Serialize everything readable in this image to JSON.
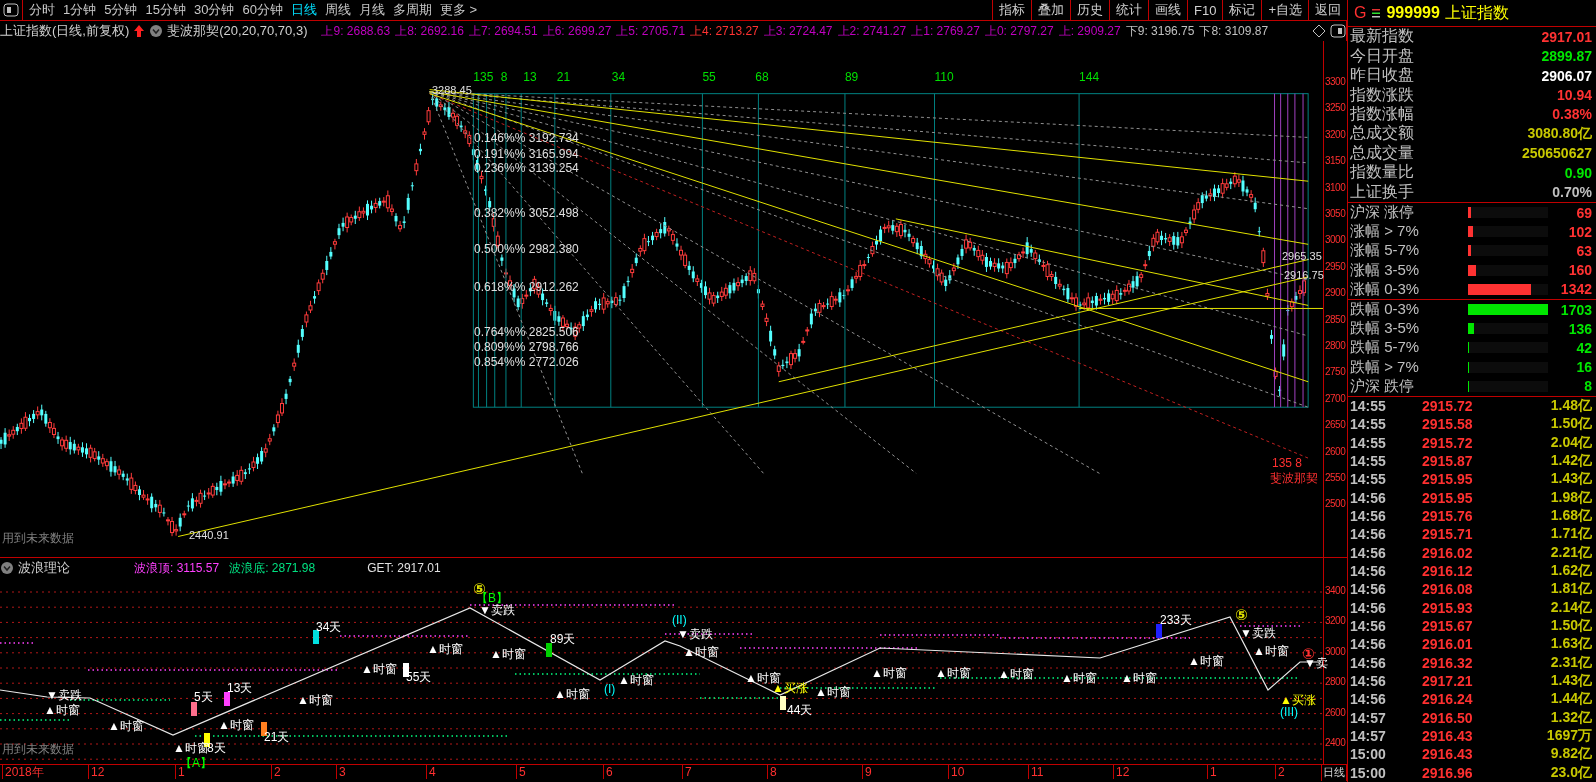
{
  "toolbar": {
    "periods": [
      {
        "label": "分时",
        "selected": false
      },
      {
        "label": "1分钟",
        "selected": false
      },
      {
        "label": "5分钟",
        "selected": false
      },
      {
        "label": "15分钟",
        "selected": false
      },
      {
        "label": "30分钟",
        "selected": false
      },
      {
        "label": "60分钟",
        "selected": false
      },
      {
        "label": "日线",
        "selected": true
      },
      {
        "label": "周线",
        "selected": false
      },
      {
        "label": "月线",
        "selected": false
      },
      {
        "label": "多周期",
        "selected": false
      },
      {
        "label": "更多 >",
        "selected": false
      }
    ],
    "buttons": [
      "指标",
      "叠加",
      "历史",
      "统计",
      "画线",
      "F10",
      "标记",
      "+自选",
      "返回"
    ]
  },
  "info_bar": {
    "title": "上证指数(日线,前复权)",
    "indicator": "斐波那契(20,20,70,70,3)",
    "levels": [
      {
        "text": "上9: 2688.63",
        "color": "#c000c0"
      },
      {
        "text": "上8: 2692.16",
        "color": "#c000c0"
      },
      {
        "text": "上7: 2694.51",
        "color": "#c000c0"
      },
      {
        "text": "上6: 2699.27",
        "color": "#c000c0"
      },
      {
        "text": "上5: 2705.71",
        "color": "#c000c0"
      },
      {
        "text": "上4: 2713.27",
        "color": "#ff3232"
      },
      {
        "text": "上3: 2724.47",
        "color": "#c000c0"
      },
      {
        "text": "上2: 2741.27",
        "color": "#c000c0"
      },
      {
        "text": "上1: 2769.27",
        "color": "#c000c0"
      },
      {
        "text": "上0: 2797.27",
        "color": "#c000c0"
      },
      {
        "text": "上: 2909.27",
        "color": "#c000c0"
      },
      {
        "text": "下9: 3196.75",
        "color": "#c0c0c0"
      },
      {
        "text": "下8: 3109.87",
        "color": "#c0c0c0"
      }
    ]
  },
  "main_chart": {
    "axis_labels": [
      "3300",
      "3250",
      "3200",
      "3150",
      "3100",
      "3050",
      "3000",
      "2950",
      "2900",
      "2850",
      "2800",
      "2750",
      "2700",
      "2650",
      "2600",
      "2550",
      "2500"
    ],
    "fib_days": [
      "135",
      "8",
      "13",
      "21",
      "34",
      "55",
      "68",
      "89",
      "110",
      "144"
    ],
    "fib_levels": [
      "0.146%% 3192.734",
      "0.191%% 3165.994",
      "0.236%% 3139.254",
      "0.382%% 3052.498",
      "0.500%% 2982.380",
      "0.618%% 2912.262",
      "0.764%% 2825.506",
      "0.809%% 2798.766",
      "0.854%% 2772.026"
    ],
    "price_marks": [
      "3288.45",
      "2440.91",
      "2965.35",
      "2916.75"
    ],
    "corner_labels": [
      "135 8",
      "斐波那契"
    ],
    "note": "用到未来数据"
  },
  "wave_panel": {
    "title": "波浪理论",
    "top_label": "波浪顶: 3115.57",
    "bottom_label": "波浪底: 2871.98",
    "get_label": "GET: 2917.01",
    "axis_labels": [
      "3400",
      "3200",
      "3000",
      "2800",
      "2600",
      "2400"
    ],
    "markers": [
      {
        "kind": "sell",
        "text": "▼卖跌"
      },
      {
        "kind": "window",
        "text": "▲时窗"
      },
      {
        "kind": "window",
        "text": "▲时窗"
      },
      {
        "kind": "days",
        "text": "5天",
        "color": "#ff6e8c"
      },
      {
        "kind": "days",
        "text": "13天",
        "color": "#ff40ff"
      },
      {
        "kind": "days",
        "text": "34天",
        "color": "#00e0e0"
      },
      {
        "kind": "window",
        "text": "▲时窗"
      },
      {
        "kind": "window",
        "text": "▲时窗"
      },
      {
        "kind": "days",
        "text": "21天",
        "color": "#ff8020"
      },
      {
        "kind": "days",
        "text": "8天",
        "color": "#ffff00"
      },
      {
        "kind": "window",
        "text": "▲时窗"
      },
      {
        "kind": "point",
        "text": "【A】"
      },
      {
        "kind": "window",
        "text": "▲时窗"
      },
      {
        "kind": "days",
        "text": "55天",
        "color": "#ffffff"
      },
      {
        "kind": "window",
        "text": "▲时窗"
      },
      {
        "kind": "count",
        "text": "⑤",
        "color": "#e0e000"
      },
      {
        "kind": "point",
        "text": "【B】"
      },
      {
        "kind": "sell",
        "text": "▼卖跌"
      },
      {
        "kind": "window",
        "text": "▲时窗"
      },
      {
        "kind": "days",
        "text": "89天",
        "color": "#00d000"
      },
      {
        "kind": "window",
        "text": "▲时窗"
      },
      {
        "kind": "wave",
        "text": "(I)"
      },
      {
        "kind": "window",
        "text": "▲时窗"
      },
      {
        "kind": "wave",
        "text": "(II)"
      },
      {
        "kind": "sell",
        "text": "▼卖跌"
      },
      {
        "kind": "window",
        "text": "▲时窗"
      },
      {
        "kind": "window",
        "text": "▲时窗"
      },
      {
        "kind": "buy",
        "text": "▲买涨"
      },
      {
        "kind": "window",
        "text": "▲时窗"
      },
      {
        "kind": "days",
        "text": "44天",
        "color": "#ffffc0"
      },
      {
        "kind": "window",
        "text": "▲时窗"
      },
      {
        "kind": "window",
        "text": "▲时窗"
      },
      {
        "kind": "window",
        "text": "▲时窗"
      },
      {
        "kind": "window",
        "text": "▲时窗"
      },
      {
        "kind": "window",
        "text": "▲时窗"
      },
      {
        "kind": "days",
        "text": "233天",
        "color": "#2020ff"
      },
      {
        "kind": "window",
        "text": "▲时窗"
      },
      {
        "kind": "count",
        "text": "⑤",
        "color": "#e0e000"
      },
      {
        "kind": "sell",
        "text": "▼卖跌"
      },
      {
        "kind": "window",
        "text": "▲时窗"
      },
      {
        "kind": "count",
        "text": "①",
        "color": "#ff3030"
      },
      {
        "kind": "sell",
        "text": "▼卖"
      },
      {
        "kind": "buy",
        "text": "▲买涨"
      },
      {
        "kind": "wave",
        "text": "(III)"
      }
    ],
    "note": "用到未来数据"
  },
  "x_axis": {
    "labels": [
      "2018年",
      "12",
      "1",
      "2",
      "3",
      "4",
      "5",
      "6",
      "7",
      "8",
      "9",
      "10",
      "11",
      "12",
      "1",
      "2"
    ],
    "period": "日线"
  },
  "quote": {
    "market": "G",
    "code": "999999",
    "name": "上证指数",
    "rows": [
      {
        "label": "最新指数",
        "value": "2917.01",
        "color": "#ff3232"
      },
      {
        "label": "今日开盘",
        "value": "2899.87",
        "color": "#00e600"
      },
      {
        "label": "昨日收盘",
        "value": "2906.07",
        "color": "#ffffff"
      },
      {
        "label": "指数涨跌",
        "value": "10.94",
        "color": "#ff3232"
      },
      {
        "label": "指数涨幅",
        "value": "0.38%",
        "color": "#ff3232"
      },
      {
        "label": "总成交额",
        "value": "3080.80亿",
        "color": "#c8c800"
      },
      {
        "label": "总成交量",
        "value": "250650627",
        "color": "#c8c800"
      },
      {
        "label": "指数量比",
        "value": "0.90",
        "color": "#00e600"
      },
      {
        "label": "上证换手",
        "value": "0.70%",
        "color": "#c0c0c0"
      }
    ]
  },
  "market_breadth": [
    {
      "label": "沪深 涨停",
      "count": "69",
      "level": 0.04,
      "color": "#ff3232"
    },
    {
      "label": "涨幅 > 7%",
      "count": "102",
      "level": 0.06,
      "color": "#ff3232"
    },
    {
      "label": "涨幅 5-7%",
      "count": "63",
      "level": 0.037,
      "color": "#ff3232"
    },
    {
      "label": "涨幅 3-5%",
      "count": "160",
      "level": 0.094,
      "color": "#ff3232"
    },
    {
      "label": "涨幅 0-3%",
      "count": "1342",
      "level": 0.788,
      "color": "#ff3232"
    },
    {
      "label": "跌幅 0-3%",
      "count": "1703",
      "level": 1,
      "color": "#00e600"
    },
    {
      "label": "跌幅 3-5%",
      "count": "136",
      "level": 0.08,
      "color": "#00e600"
    },
    {
      "label": "跌幅 5-7%",
      "count": "42",
      "level": 0.012,
      "color": "#00e600"
    },
    {
      "label": "跌幅 > 7%",
      "count": "16",
      "level": 0.01,
      "color": "#00e600"
    },
    {
      "label": "沪深 跌停",
      "count": "8",
      "level": 0.01,
      "color": "#00e600"
    }
  ],
  "ticks": [
    {
      "time": "14:55",
      "price": "2915.72",
      "amount": "1.48亿"
    },
    {
      "time": "14:55",
      "price": "2915.58",
      "amount": "1.50亿"
    },
    {
      "time": "14:55",
      "price": "2915.72",
      "amount": "2.04亿"
    },
    {
      "time": "14:55",
      "price": "2915.87",
      "amount": "1.42亿"
    },
    {
      "time": "14:55",
      "price": "2915.95",
      "amount": "1.43亿"
    },
    {
      "time": "14:56",
      "price": "2915.95",
      "amount": "1.98亿"
    },
    {
      "time": "14:56",
      "price": "2915.76",
      "amount": "1.68亿"
    },
    {
      "time": "14:56",
      "price": "2915.71",
      "amount": "1.71亿"
    },
    {
      "time": "14:56",
      "price": "2916.02",
      "amount": "2.21亿"
    },
    {
      "time": "14:56",
      "price": "2916.12",
      "amount": "1.62亿"
    },
    {
      "time": "14:56",
      "price": "2916.08",
      "amount": "1.81亿"
    },
    {
      "time": "14:56",
      "price": "2915.93",
      "amount": "2.14亿"
    },
    {
      "time": "14:56",
      "price": "2915.67",
      "amount": "1.50亿"
    },
    {
      "time": "14:56",
      "price": "2916.01",
      "amount": "1.63亿"
    },
    {
      "time": "14:56",
      "price": "2916.32",
      "amount": "2.31亿"
    },
    {
      "time": "14:56",
      "price": "2917.21",
      "amount": "1.43亿"
    },
    {
      "time": "14:56",
      "price": "2916.24",
      "amount": "1.44亿"
    },
    {
      "time": "14:57",
      "price": "2916.50",
      "amount": "1.32亿"
    },
    {
      "time": "14:57",
      "price": "2916.43",
      "amount": "1697万"
    },
    {
      "time": "15:00",
      "price": "2916.43",
      "amount": "9.82亿"
    },
    {
      "time": "15:00",
      "price": "2916.96",
      "amount": "23.0亿"
    }
  ]
}
